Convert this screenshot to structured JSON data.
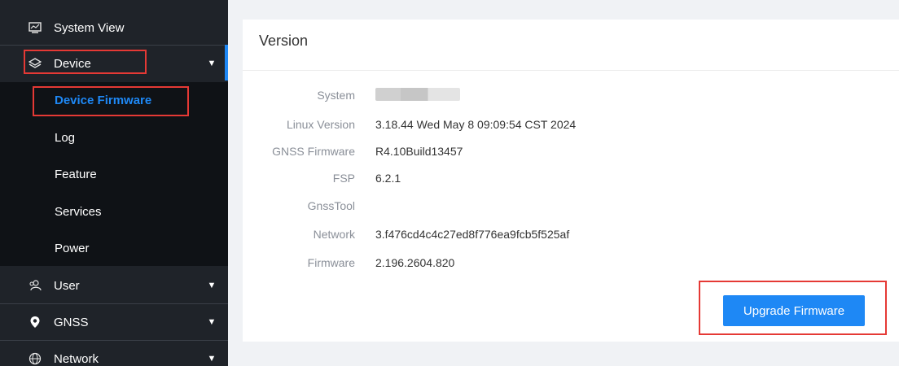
{
  "sidebar": {
    "system_view": {
      "label": "System View",
      "icon": "monitor-icon"
    },
    "device": {
      "label": "Device",
      "icon": "layers-icon"
    },
    "device_children": [
      "Device Firmware",
      "Log",
      "Feature",
      "Services",
      "Power"
    ],
    "user": {
      "label": "User",
      "icon": "users-icon"
    },
    "gnss": {
      "label": "GNSS",
      "icon": "location-pin-icon"
    },
    "network": {
      "label": "Network",
      "icon": "globe-icon"
    },
    "active_item": "Device Firmware",
    "colors": {
      "background": "#1f2329",
      "submenu_background": "#0f1216",
      "accent": "#1e88f5"
    }
  },
  "version_card": {
    "title": "Version",
    "rows": [
      {
        "label": "System",
        "value": ""
      },
      {
        "label": "Linux Version",
        "value": "3.18.44 Wed May 8 09:09:54 CST 2024"
      },
      {
        "label": "GNSS Firmware",
        "value": "R4.10Build13457"
      },
      {
        "label": "FSP",
        "value": "6.2.1"
      },
      {
        "label": "GnssTool",
        "value": ""
      },
      {
        "label": "Network",
        "value": "3.f476cd4c4c27ed8f776ea9fcb5f525af"
      },
      {
        "label": "Firmware",
        "value": "2.196.2604.820"
      }
    ],
    "upgrade_button": "Upgrade Firmware"
  },
  "annotations": {
    "highlight_color": "#e53935"
  }
}
